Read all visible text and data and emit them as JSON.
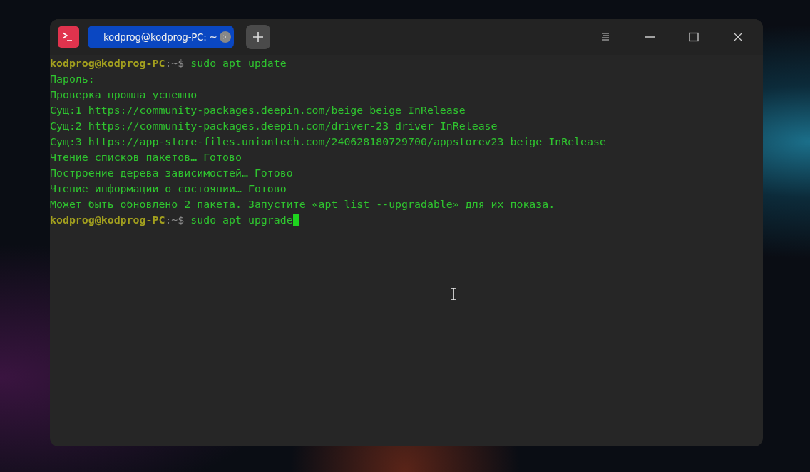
{
  "window": {
    "tabs": [
      {
        "label": "kodprog@kodprog-PC: ~",
        "selected": true
      }
    ]
  },
  "terminal": {
    "lines": [
      {
        "kind": "prompt",
        "user": "kodprog@kodprog-PC",
        "path": ":~$",
        "command": "sudo apt update",
        "cursor": false
      },
      {
        "kind": "output",
        "text": "Пароль:"
      },
      {
        "kind": "output",
        "text": "Проверка прошла успешно"
      },
      {
        "kind": "output",
        "text": "Сущ:1 https://community-packages.deepin.com/beige beige InRelease"
      },
      {
        "kind": "output",
        "text": "Сущ:2 https://community-packages.deepin.com/driver-23 driver InRelease"
      },
      {
        "kind": "output",
        "text": "Сущ:3 https://app-store-files.uniontech.com/240628180729700/appstorev23 beige InRelease"
      },
      {
        "kind": "output",
        "text": "Чтение списков пакетов… Готово"
      },
      {
        "kind": "output",
        "text": "Построение дерева зависимостей… Готово"
      },
      {
        "kind": "output",
        "text": "Чтение информации о состоянии… Готово"
      },
      {
        "kind": "output",
        "text": "Может быть обновлено 2 пакета. Запустите «apt list --upgradable» для их показа."
      },
      {
        "kind": "prompt",
        "user": "kodprog@kodprog-PC",
        "path": ":~$",
        "command": "sudo apt upgrade",
        "cursor": true
      }
    ]
  }
}
